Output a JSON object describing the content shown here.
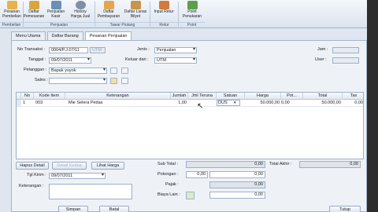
{
  "ribbon": {
    "buttons": [
      {
        "label": "Pesanan Pembelian",
        "color": "#e8b24a"
      },
      {
        "label": "Daftar Pemesanan",
        "color": "#d9a53f"
      },
      {
        "label": "Penjualan Kasir",
        "color": "#6c8fb5"
      },
      {
        "label": "History Harga Jual",
        "color": "#7f8fa6"
      },
      {
        "label": "Daftar Pembayaran",
        "color": "#e2a64e"
      },
      {
        "label": "Daftar Lunas Bilyet",
        "color": "#c8944a"
      },
      {
        "label": "Input Retur",
        "color": "#d27a3c"
      },
      {
        "label": "Point Penukaran",
        "color": "#5aa04a"
      }
    ],
    "groups": [
      "Pembelian",
      "Penjualan",
      "Tawar Piutang",
      "Retur",
      "Point"
    ]
  },
  "tabs": [
    "Menu Utama",
    "Daftar Barang",
    "Pesanan Penjualan"
  ],
  "form": {
    "no_transaksi_label": "No Transaksi :",
    "no_transaksi_value": "0004/P.J.07/11",
    "tanggal_label": "Tanggal :",
    "tanggal_value": "09/07/2011",
    "pelanggan_label": "Pelanggan :",
    "pelanggan_value": "Bapak yoyok",
    "sales_label": "Sales :",
    "sales_value": "",
    "jenis_label": "Jenis :",
    "jenis_value": "Penjualan",
    "keluar_dari_label": "Keluar dari :",
    "keluar_dari_value": "UTM",
    "jam_label": "Jam :",
    "jam_value": "",
    "user_label": "User :",
    "user_value": "",
    "utm_tag": "UTM"
  },
  "grid": {
    "headers": [
      "No",
      "Kode Item",
      "Keterangan",
      "Jumlah",
      "Jml Teruna",
      "Satuan",
      "Harga",
      "Pot...",
      "Total",
      "Tax"
    ],
    "rows": [
      {
        "no": "1",
        "kode": "003",
        "keterangan": "Mie Selera Pedas",
        "jumlah": "1,00",
        "jml_teruna": "",
        "satuan": "DUS",
        "harga": "50.000,00",
        "pot": "0,00",
        "total": "50.000,00",
        "tax": "0,00"
      }
    ]
  },
  "buttons": {
    "hapus_detail": "Hapus Detail",
    "detail_kedua": "Detail Kedua",
    "lihat_harga": "Lihat Harga"
  },
  "footer": {
    "tgl_kirim_label": "Tgl Kirim :",
    "tgl_kirim_value": "09/07/2011",
    "keterangan_label": "Keterangan :",
    "subtotal_label": "Sub Total :",
    "subtotal_value": "0,00",
    "potongan_label": "Potongan :",
    "potongan_pct": "0,00",
    "potongan_value": "0,00",
    "pajak_label": "Pajak :",
    "pajak_value": "0,00",
    "biaya_lain_label": "Biaya Lain :",
    "biaya_lain_value": "0,00",
    "total_akhir_label": "Total Akhir :",
    "total_akhir_value": "0,00"
  },
  "bottom_buttons": [
    "Simpan",
    "Batal",
    "Tutup"
  ]
}
